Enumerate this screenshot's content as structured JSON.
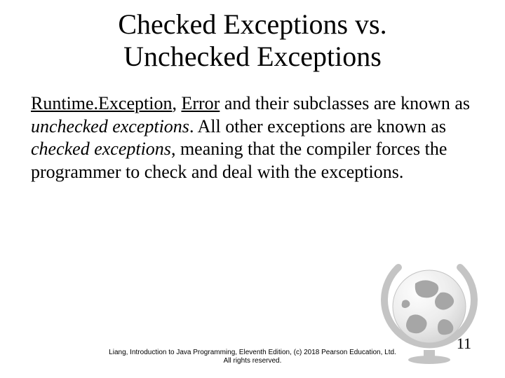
{
  "title": {
    "line1": "Checked Exceptions vs.",
    "line2": "Unchecked Exceptions"
  },
  "body": {
    "part1": "Runtime.Exception",
    "sep1": ", ",
    "part2": "Error",
    "part3": " and their subclasses are known as ",
    "part4": "unchecked exceptions",
    "part5": ". All other exceptions are known as ",
    "part6": "checked exceptions",
    "part7": ", meaning that the compiler forces the programmer to check and deal with the exceptions."
  },
  "footer": {
    "line1": "Liang, Introduction to Java Programming, Eleventh Edition, (c) 2018 Pearson Education, Ltd.",
    "line2": "All rights reserved."
  },
  "page_number": "11"
}
